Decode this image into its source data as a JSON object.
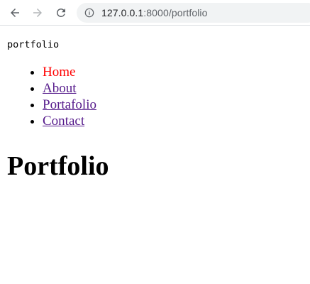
{
  "browser": {
    "back_icon": "arrow-left-icon",
    "forward_icon": "arrow-right-icon",
    "reload_icon": "reload-icon",
    "info_icon": "info-icon",
    "url_host": "127.0.0.1",
    "url_rest": ":8000/portfolio"
  },
  "header": {
    "brand": "portfolio"
  },
  "nav": {
    "items": [
      {
        "label": "Home",
        "active": true
      },
      {
        "label": "About",
        "active": false
      },
      {
        "label": "Portafolio",
        "active": false
      },
      {
        "label": "Contact",
        "active": false
      }
    ]
  },
  "main": {
    "title": "Portfolio"
  },
  "colors": {
    "active_link": "#ff0000",
    "visited_link": "#551a8b",
    "omnibox_bg": "#f1f3f4"
  }
}
